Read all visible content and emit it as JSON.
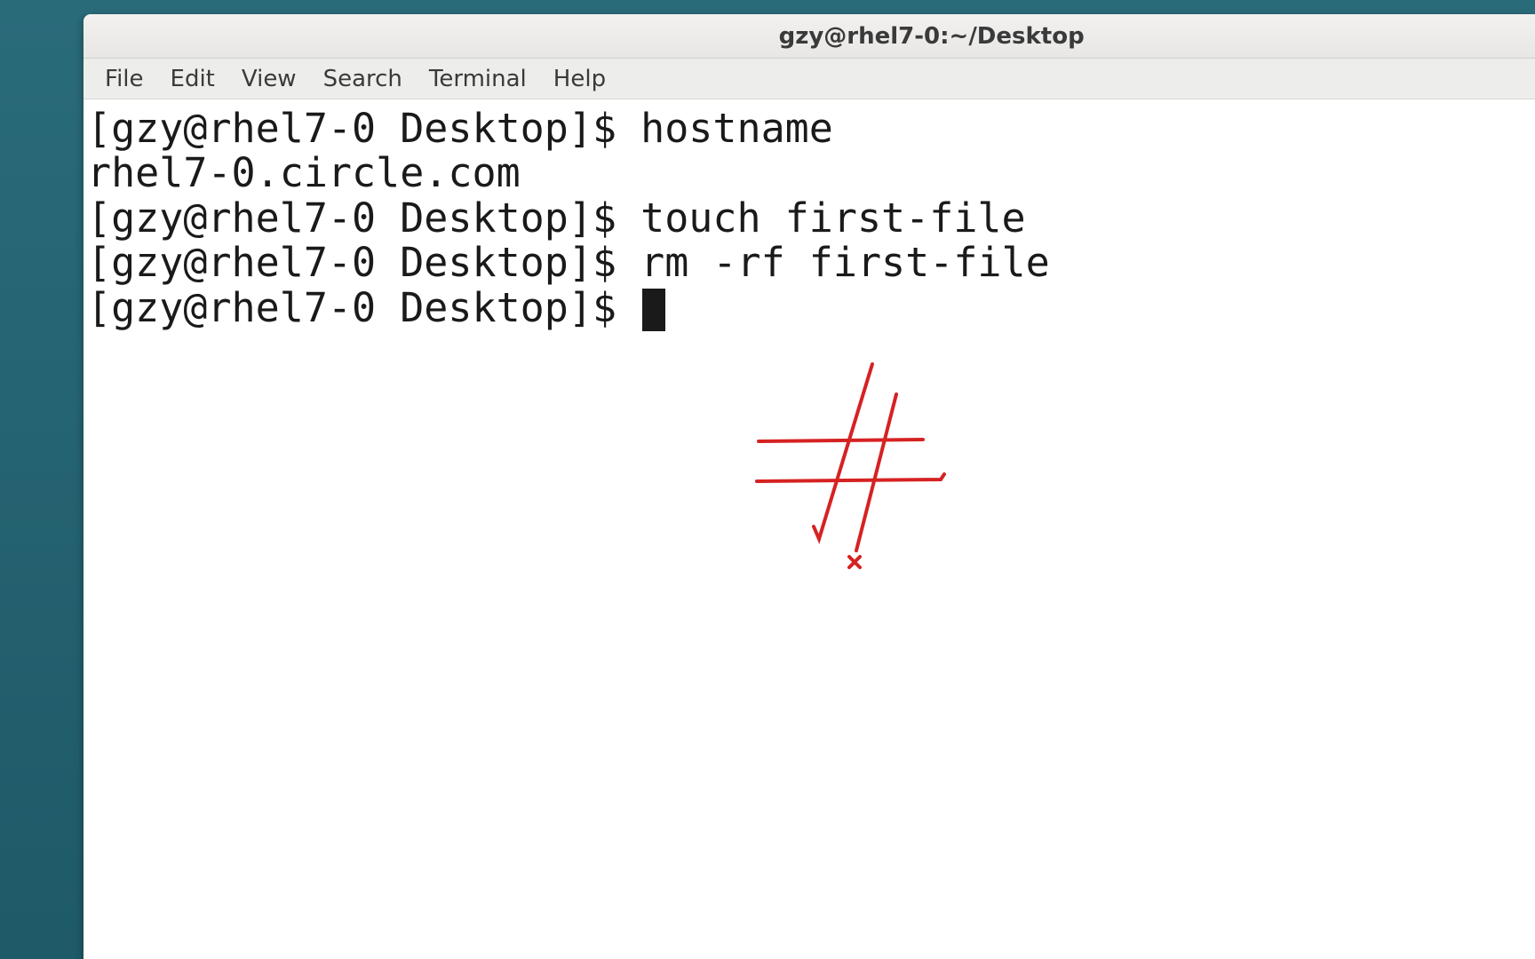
{
  "titlebar": {
    "title": "gzy@rhel7-0:~/Desktop"
  },
  "menubar": {
    "items": [
      {
        "label": "File"
      },
      {
        "label": "Edit"
      },
      {
        "label": "View"
      },
      {
        "label": "Search"
      },
      {
        "label": "Terminal"
      },
      {
        "label": "Help"
      }
    ]
  },
  "terminal": {
    "lines": [
      {
        "prompt": "[gzy@rhel7-0 Desktop]$ ",
        "command": "hostname"
      },
      {
        "output": "rhel7-0.circle.com"
      },
      {
        "prompt": "[gzy@rhel7-0 Desktop]$ ",
        "command": "touch first-file"
      },
      {
        "prompt": "[gzy@rhel7-0 Desktop]$ ",
        "command": "rm -rf first-file"
      },
      {
        "prompt": "[gzy@rhel7-0 Desktop]$ ",
        "cursor": true
      }
    ]
  },
  "annotation": {
    "color": "#d62222"
  }
}
